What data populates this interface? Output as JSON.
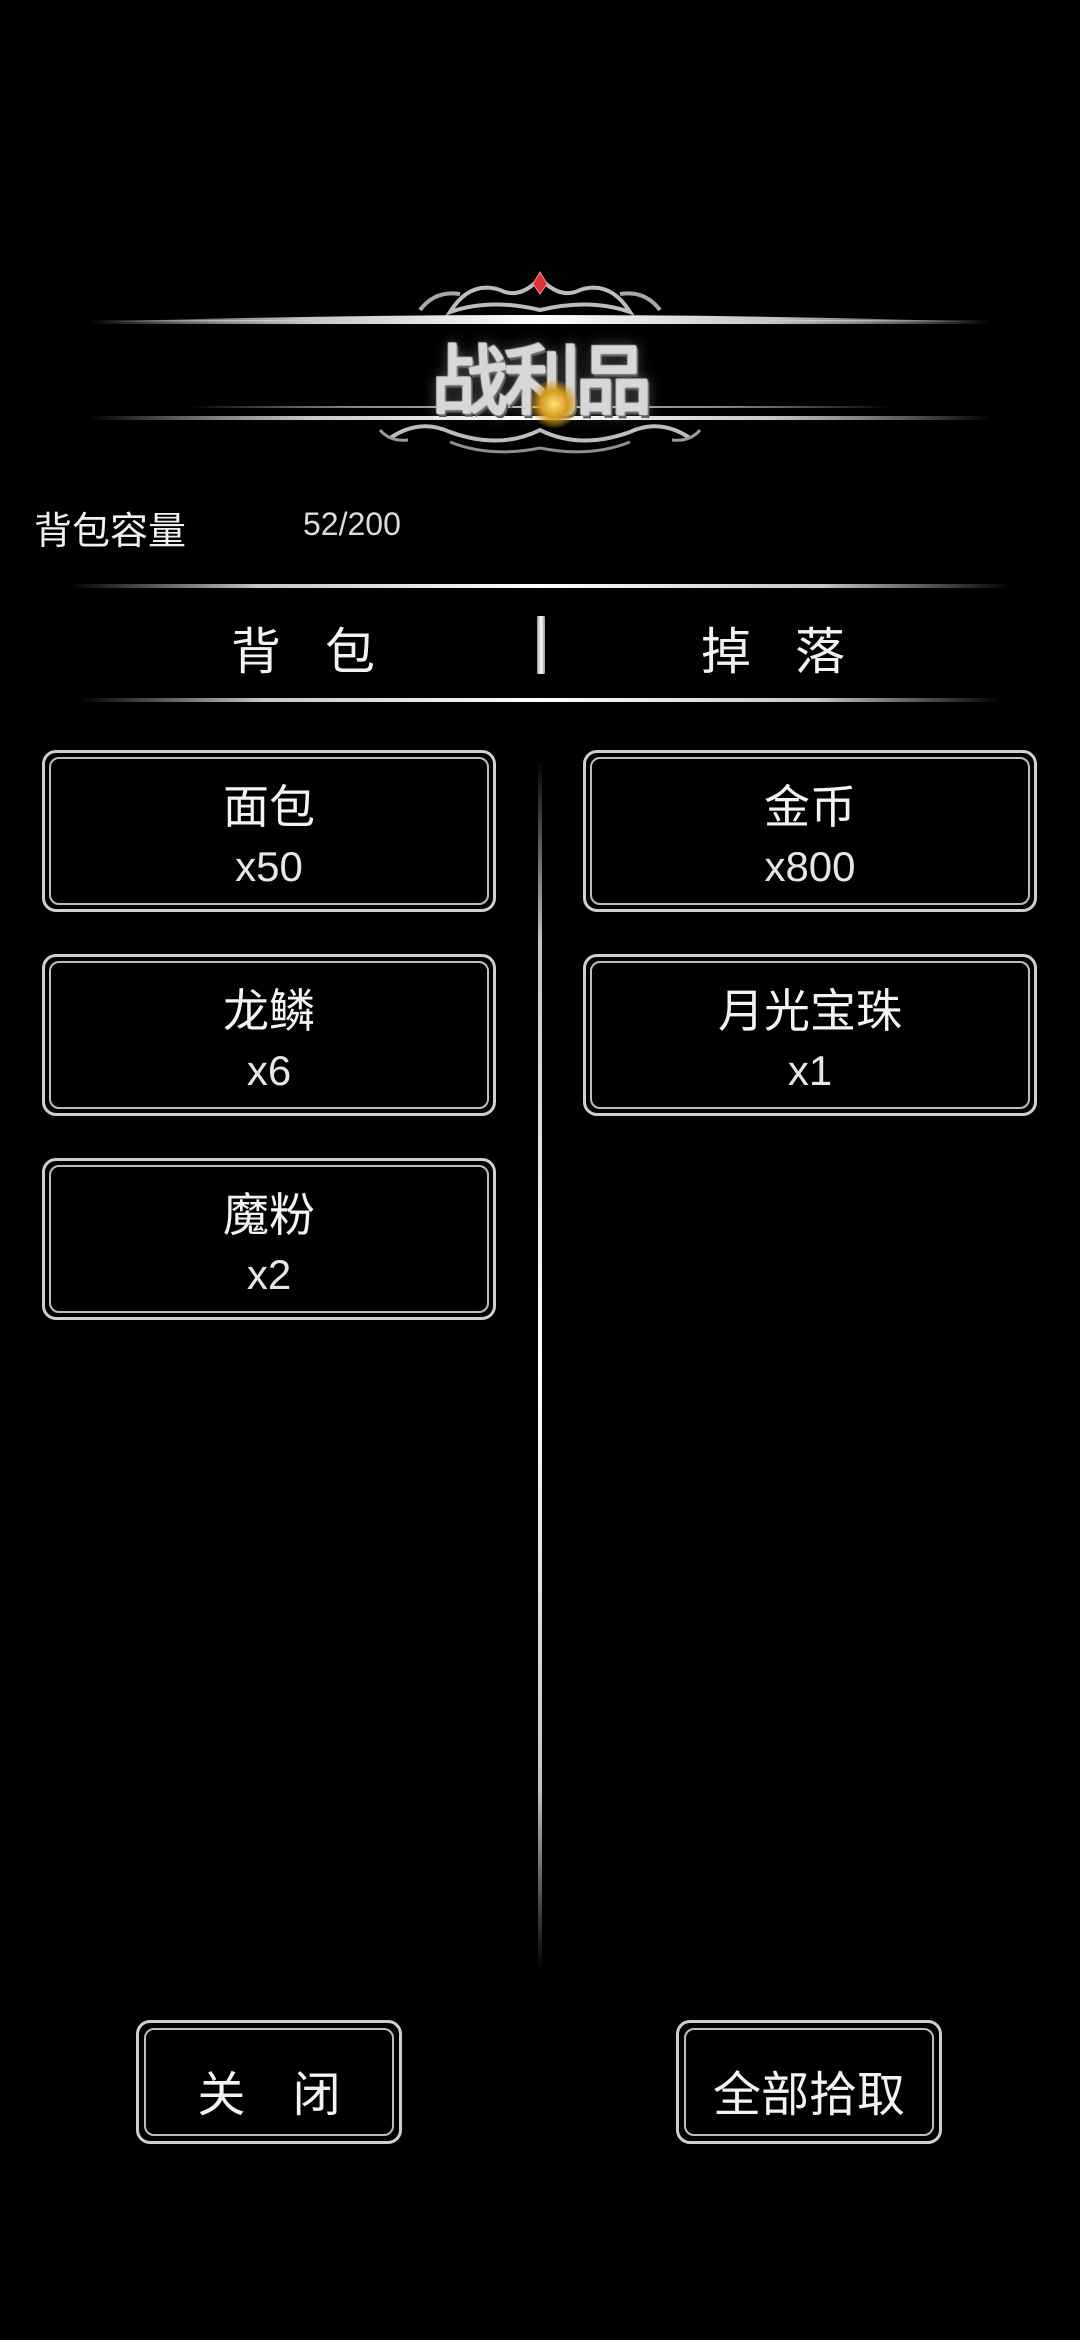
{
  "title": "战利品",
  "capacity": {
    "label": "背包容量",
    "value": "52/200"
  },
  "tabs": [
    {
      "label": "背 包"
    },
    {
      "label": "掉 落"
    }
  ],
  "backpack_items": [
    {
      "name": "面包",
      "qty": "x50"
    },
    {
      "name": "龙鳞",
      "qty": "x6"
    },
    {
      "name": "魔粉",
      "qty": "x2"
    }
  ],
  "drop_items": [
    {
      "name": "金币",
      "qty": "x800"
    },
    {
      "name": "月光宝珠",
      "qty": "x1"
    }
  ],
  "buttons": {
    "close": "关 闭",
    "pick_all": "全部拾取"
  },
  "colors": {
    "background": "#000000",
    "text": "#f0f0f0",
    "border": "#cfcfcf",
    "gem": "#e0303a",
    "glow": "#ffd45a"
  }
}
